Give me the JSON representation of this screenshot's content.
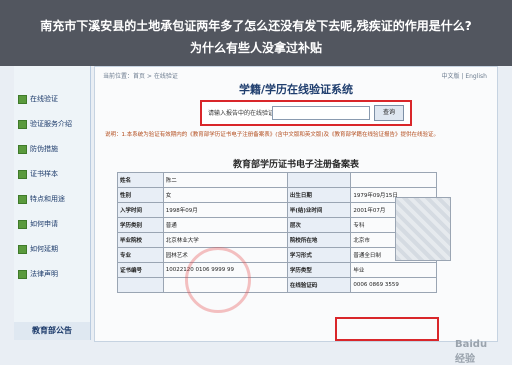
{
  "banner": {
    "line1": "南充市下溪安县的土地承包证两年多了怎么还没有发下去呢,残疾证的作用是什么?",
    "line2": "为什么有些人没拿过补贴"
  },
  "breadcrumb": "当前位置：首页 > 在线验证",
  "lang": "中文版 | English",
  "sidebar": {
    "items": [
      {
        "label": "在线验证"
      },
      {
        "label": "验证服务介绍"
      },
      {
        "label": "防伪措施"
      },
      {
        "label": "证书样本"
      },
      {
        "label": "特点和用途"
      },
      {
        "label": "如何申请"
      },
      {
        "label": "如何延期"
      },
      {
        "label": "法律声明"
      }
    ],
    "notice": "教育部公告"
  },
  "main": {
    "title": "学籍/学历在线验证系统",
    "search_label": "请输入报告中的在线验证码：",
    "search_button": "查询",
    "note": "说明：1.本系统为验证有效期内的《教育部学历证书电子注册备案表》(含中文版和英文版)及《教育部学籍在线验证报告》提供在线验证。",
    "cert_title": "教育部学历证书电子注册备案表"
  },
  "cert_rows": [
    {
      "k1": "姓名",
      "v1": "陈二",
      "k2": "",
      "v2": ""
    },
    {
      "k1": "性别",
      "v1": "女",
      "k2": "出生日期",
      "v2": "1979年09月15日"
    },
    {
      "k1": "入学时间",
      "v1": "1998年09月",
      "k2": "毕(结)业时间",
      "v2": "2001年07月"
    },
    {
      "k1": "学历类别",
      "v1": "普通",
      "k2": "层次",
      "v2": "专科"
    },
    {
      "k1": "毕业院校",
      "v1": "北京林业大学",
      "k2": "院校所在地",
      "v2": "北京市"
    },
    {
      "k1": "专业",
      "v1": "园林艺术",
      "k2": "学习形式",
      "v2": "普通全日制"
    },
    {
      "k1": "证书编号",
      "v1": "10022120 0106 9999 99",
      "k2": "学历类型",
      "v2": "毕业"
    },
    {
      "k1": "",
      "v1": "",
      "k2": "在线验证码",
      "v2": "0006 0869 3559"
    }
  ],
  "watermark": "Baidu经验"
}
